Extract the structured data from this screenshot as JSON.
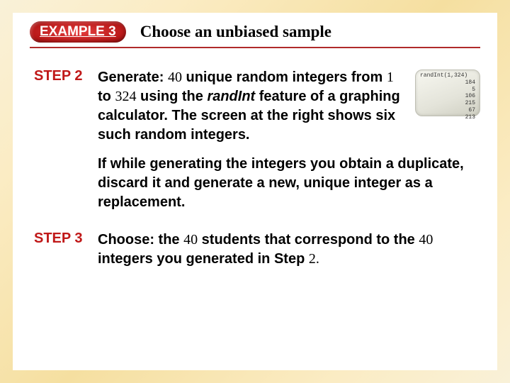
{
  "header": {
    "badge": "EXAMPLE 3",
    "title": "Choose an unbiased sample"
  },
  "step2": {
    "label": "STEP 2",
    "generate_word": "Generate:",
    "count": "40",
    "text_a": " unique random integers from ",
    "range_low": "1",
    "text_b": " to ",
    "range_high": "324",
    "text_c": " using the ",
    "func": "randInt",
    "text_d": " feature of a graphing calculator. The screen at the right shows six such random  integers.",
    "note": "If while generating the integers you obtain a duplicate, discard it and generate a new, unique integer as a replacement."
  },
  "step3": {
    "label": "STEP 3",
    "choose_word": "Choose:",
    "text_a": " the ",
    "count": "40",
    "text_b": " students that correspond to the ",
    "count2": "40",
    "text_c": " integers you generated in Step ",
    "ref": "2."
  },
  "calc": {
    "command": "randInt(1,324)",
    "values": [
      "184",
      "5",
      "106",
      "215",
      "67",
      "213"
    ]
  }
}
